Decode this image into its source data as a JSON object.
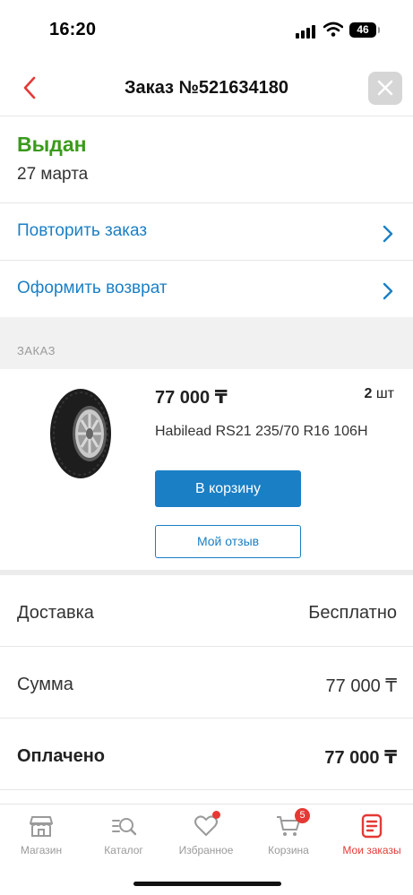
{
  "status_bar": {
    "time": "16:20",
    "battery": "46"
  },
  "header": {
    "title": "Заказ №521634180"
  },
  "order": {
    "status": "Выдан",
    "date": "27 марта"
  },
  "actions": [
    {
      "label": "Повторить заказ"
    },
    {
      "label": "Оформить возврат"
    }
  ],
  "section": {
    "label": "ЗАКАЗ"
  },
  "product": {
    "price": "77 000 ₸",
    "qty_value": "2",
    "qty_unit": "шт",
    "name": "Habilead RS21 235/70 R16 106H",
    "cart_button": "В корзину",
    "review_button": "Мой отзыв"
  },
  "summary": [
    {
      "label": "Доставка",
      "value": "Бесплатно"
    },
    {
      "label": "Сумма",
      "value": "77 000 ₸"
    },
    {
      "label": "Оплачено",
      "value": "77 000 ₸"
    }
  ],
  "tabs": [
    {
      "label": "Магазин",
      "icon": "shop-icon"
    },
    {
      "label": "Каталог",
      "icon": "catalog-icon"
    },
    {
      "label": "Избранное",
      "icon": "heart-icon"
    },
    {
      "label": "Корзина",
      "icon": "cart-icon",
      "badge": "5"
    },
    {
      "label": "Мои заказы",
      "icon": "orders-icon",
      "active": true
    }
  ],
  "colors": {
    "accent": "#1a7fc5",
    "status_green": "#3a9a1c",
    "active_tab": "#e53935"
  }
}
